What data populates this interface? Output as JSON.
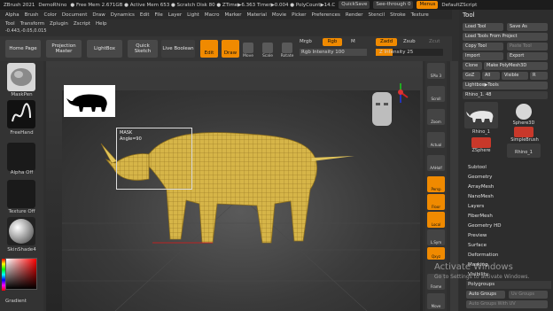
{
  "titlebar": {
    "app": "ZBrush 2021",
    "doc": "DemoRhino",
    "status": "● Free Mem 2.671GB ● Active Mem 653 ● Scratch Disk 80 ● ZTime▶6.363 Timer▶0.004 ● PolyCount▶14.C",
    "quicksave": "QuickSave",
    "seethrough": "See-through 0",
    "menus": "Menus",
    "script": "DefaultZScript"
  },
  "menu": {
    "row1": [
      "Alpha",
      "Brush",
      "Color",
      "Document",
      "Draw",
      "Dynamics",
      "Edit",
      "File",
      "Layer",
      "Light",
      "Macro",
      "Marker",
      "Material",
      "Movie",
      "Picker",
      "Preferences",
      "Render",
      "Stencil",
      "Stroke",
      "Texture"
    ],
    "row2": [
      "Tool",
      "Transform",
      "Zplugin",
      "Zscript",
      "Help"
    ]
  },
  "coords": "-0.443,-0.05,0.015",
  "toolbar": {
    "home_page": "Home Page",
    "projection_master": "Projection Master",
    "lightbox": "LightBox",
    "quick_sketch": "Quick Sketch",
    "live_boolean": "Live Boolean",
    "edit": "Edit",
    "draw": "Draw",
    "move": "Move",
    "scale": "Scale",
    "rotate": "Rotate",
    "mrgb": "Mrgb",
    "rgb": "Rgb",
    "m": "M",
    "rgb_intensity": "Rgb Intensity 100",
    "zadd": "Zadd",
    "zsub": "Zsub",
    "zcut": "Zcut",
    "z_intensity": "Z Intensity 25",
    "z_intensity_value": 25
  },
  "left": {
    "brush_label": "MaskPen",
    "stroke_label": "FreeHand",
    "alpha_label": "Alpha Off",
    "texture_label": "Texture Off",
    "material_label": "SkinShade4",
    "gradient_label": "Gradient"
  },
  "viewport": {
    "mask_title": "MASK",
    "mask_angle": "Angle=90"
  },
  "rightnav": [
    "SPix 3",
    "Scroll",
    "Zoom",
    "Actual",
    "AAHalf",
    "Persp",
    "Floor",
    "Local",
    "L.Sym",
    "Qxyz",
    "Frame",
    "Move"
  ],
  "panel": {
    "title": "Tool",
    "load_tool": "Load Tool",
    "save_as": "Save As",
    "load_from_project": "Load Tools From Project",
    "copy_tool": "Copy Tool",
    "paste_tool": "Paste Tool",
    "import": "Import",
    "export": "Export",
    "clone": "Clone",
    "make_polymesh": "Make PolyMesh3D",
    "goz": "GoZ",
    "all": "All",
    "visible": "Visible",
    "r": "R",
    "lightbox_tools": "Lightbox▶Tools",
    "current_tool": "Rhino_1. 48",
    "thumbs": [
      "Rhino_1",
      "Sphere3D",
      "SimpleBrush",
      "ZSphere",
      "Rhino_1"
    ],
    "sections": [
      "Subtool",
      "Geometry",
      "ArrayMesh",
      "NanoMesh",
      "Layers",
      "FiberMesh",
      "Geometry HD",
      "Preview",
      "Surface",
      "Deformation",
      "Masking",
      "Visibility",
      "Polygroups"
    ],
    "auto_groups": "Auto Groups",
    "uv_groups": "Uv Groups",
    "auto_groups_uv": "Auto Groups With UV"
  },
  "watermark": {
    "title": "Activate Windows",
    "sub": "Go to Settings to activate Windows."
  },
  "colors": {
    "accent": "#f08a00",
    "panel": "#2d2d2d",
    "mesh": "#d9b84a"
  }
}
